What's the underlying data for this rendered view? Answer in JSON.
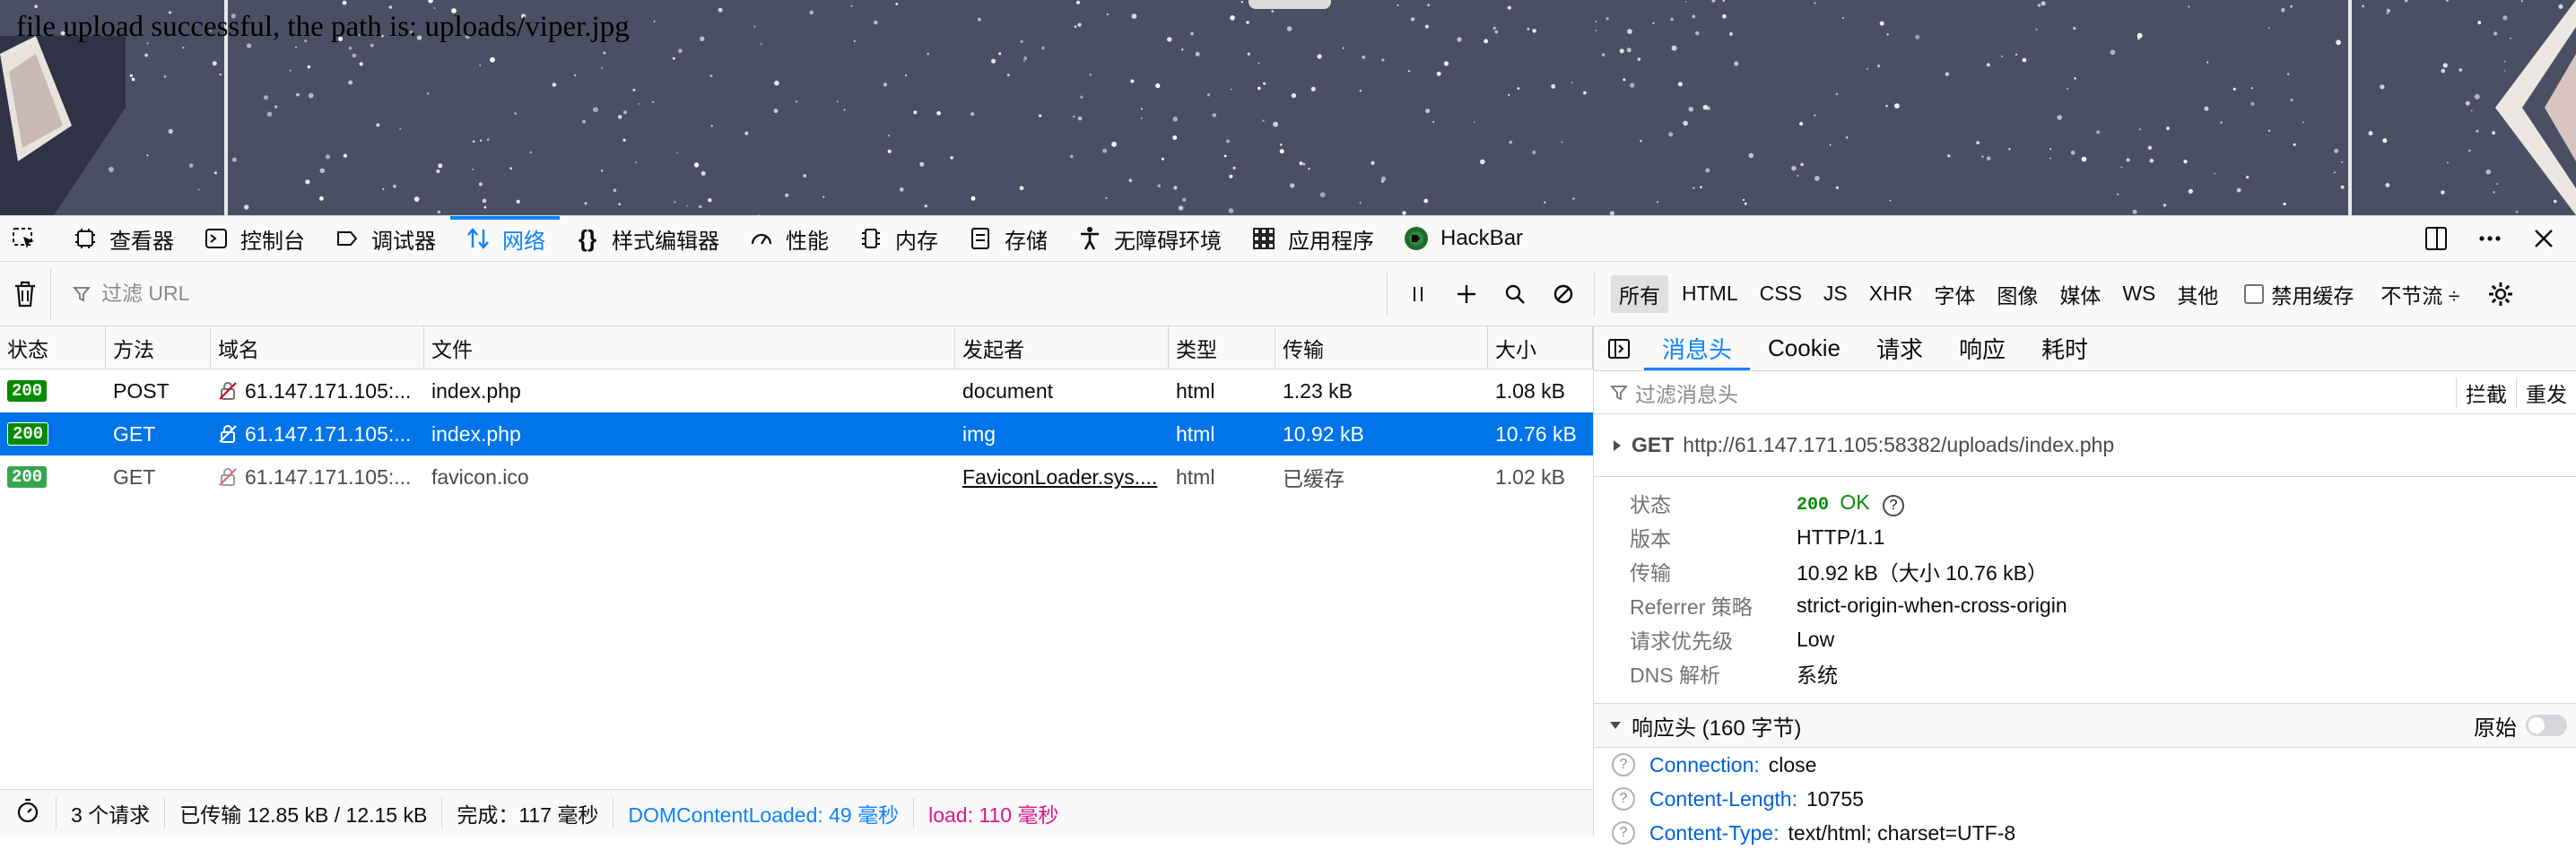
{
  "page": {
    "message": "file upload successful, the path is: uploads/viper.jpg"
  },
  "toolbox": {
    "tabs": [
      {
        "label": "查看器",
        "icon": "inspector-icon"
      },
      {
        "label": "控制台",
        "icon": "console-icon"
      },
      {
        "label": "调试器",
        "icon": "debugger-icon"
      },
      {
        "label": "网络",
        "icon": "network-icon",
        "active": true
      },
      {
        "label": "样式编辑器",
        "icon": "style-editor-icon"
      },
      {
        "label": "性能",
        "icon": "performance-icon"
      },
      {
        "label": "内存",
        "icon": "memory-icon"
      },
      {
        "label": "存储",
        "icon": "storage-icon"
      },
      {
        "label": "无障碍环境",
        "icon": "accessibility-icon"
      },
      {
        "label": "应用程序",
        "icon": "application-icon"
      },
      {
        "label": "HackBar",
        "icon": "hackbar-icon"
      }
    ]
  },
  "netbar": {
    "filter_placeholder": "过滤 URL",
    "type_filters": [
      "所有",
      "HTML",
      "CSS",
      "JS",
      "XHR",
      "字体",
      "图像",
      "媒体",
      "WS",
      "其他"
    ],
    "disable_cache_label": "禁用缓存",
    "throttle_label": "不节流 ÷"
  },
  "table": {
    "headers": [
      "状态",
      "方法",
      "域名",
      "文件",
      "发起者",
      "类型",
      "传输",
      "大小"
    ],
    "rows": [
      {
        "status": "200",
        "method": "POST",
        "domain": "61.147.171.105:...",
        "file": "index.php",
        "initiator": "document",
        "type": "html",
        "transferred": "1.23 kB",
        "size": "1.08 kB"
      },
      {
        "status": "200",
        "method": "GET",
        "domain": "61.147.171.105:...",
        "file": "index.php",
        "initiator": "img",
        "type": "html",
        "transferred": "10.92 kB",
        "size": "10.76 kB"
      },
      {
        "status": "200",
        "method": "GET",
        "domain": "61.147.171.105:...",
        "file": "favicon.ico",
        "initiator": "FaviconLoader.sys....",
        "type": "html",
        "transferred": "已缓存",
        "size": "1.02 kB"
      }
    ]
  },
  "statusbar": {
    "requests": "3 个请求",
    "transferred": "已传输 12.85 kB / 12.15 kB",
    "finish": "完成：117 毫秒",
    "dcl": "DOMContentLoaded: 49 毫秒",
    "load": "load: 110 毫秒"
  },
  "sidebar": {
    "tabs": [
      "消息头",
      "Cookie",
      "请求",
      "响应",
      "耗时"
    ],
    "filter_placeholder": "过滤消息头",
    "actions": [
      "拦截",
      "重发"
    ],
    "request": {
      "method": "GET",
      "url": "http://61.147.171.105:58382/uploads/index.php"
    },
    "summary": [
      {
        "key": "状态",
        "value": "OK",
        "code": "200"
      },
      {
        "key": "版本",
        "value": "HTTP/1.1"
      },
      {
        "key": "传输",
        "value": "10.92 kB（大小 10.76 kB）"
      },
      {
        "key": "Referrer 策略",
        "value": "strict-origin-when-cross-origin"
      },
      {
        "key": "请求优先级",
        "value": "Low"
      },
      {
        "key": "DNS 解析",
        "value": "系统"
      }
    ],
    "response_headers_title": "响应头 (160 字节)",
    "raw_label": "原始",
    "headers": [
      {
        "name": "Connection:",
        "value": "close"
      },
      {
        "name": "Content-Length:",
        "value": "10755"
      },
      {
        "name": "Content-Type:",
        "value": "text/html; charset=UTF-8"
      }
    ]
  },
  "colors": {
    "accent": "#0a84ff",
    "selected_row": "#0074e8",
    "status_ok": "#058b00",
    "load": "#e31587"
  }
}
